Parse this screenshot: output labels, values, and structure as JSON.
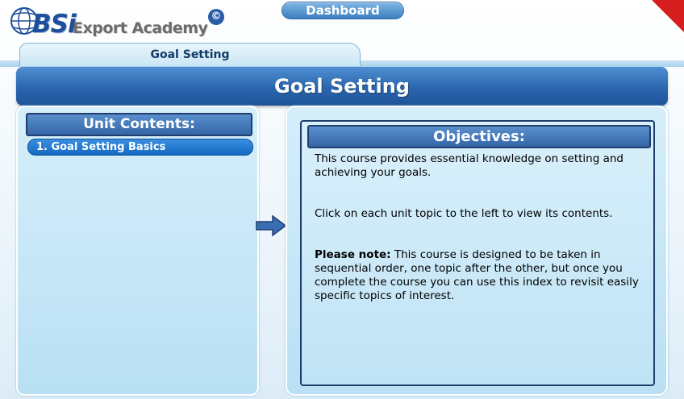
{
  "header": {
    "logo_bsi": "BSi",
    "logo_academy": "Export Academy",
    "copyright_symbol": "©",
    "dashboard_label": "Dashboard"
  },
  "breadcrumb": {
    "label": "Goal Setting"
  },
  "page_title": "Goal Setting",
  "unit_contents": {
    "heading": "Unit Contents:",
    "items": [
      {
        "label": "1. Goal Setting Basics"
      }
    ]
  },
  "objectives": {
    "heading": "Objectives:",
    "paragraph_1": "This course provides essential knowledge on setting and achieving your goals.",
    "paragraph_2": "Click on each unit topic to the left to view its contents.",
    "note_label": "Please note:",
    "note_text": " This course is designed to be taken in sequential order, one topic after the other, but once you complete the course you can use this index to revisit easily specific topics of interest."
  },
  "colors": {
    "title_bar": "#2a66ae",
    "panel_bg": "#c7e7f6",
    "selected_item": "#1469c2",
    "corner_flag": "#d61e1e"
  },
  "icons": [
    "globe-icon",
    "copyright-icon",
    "arrow-right-icon"
  ]
}
